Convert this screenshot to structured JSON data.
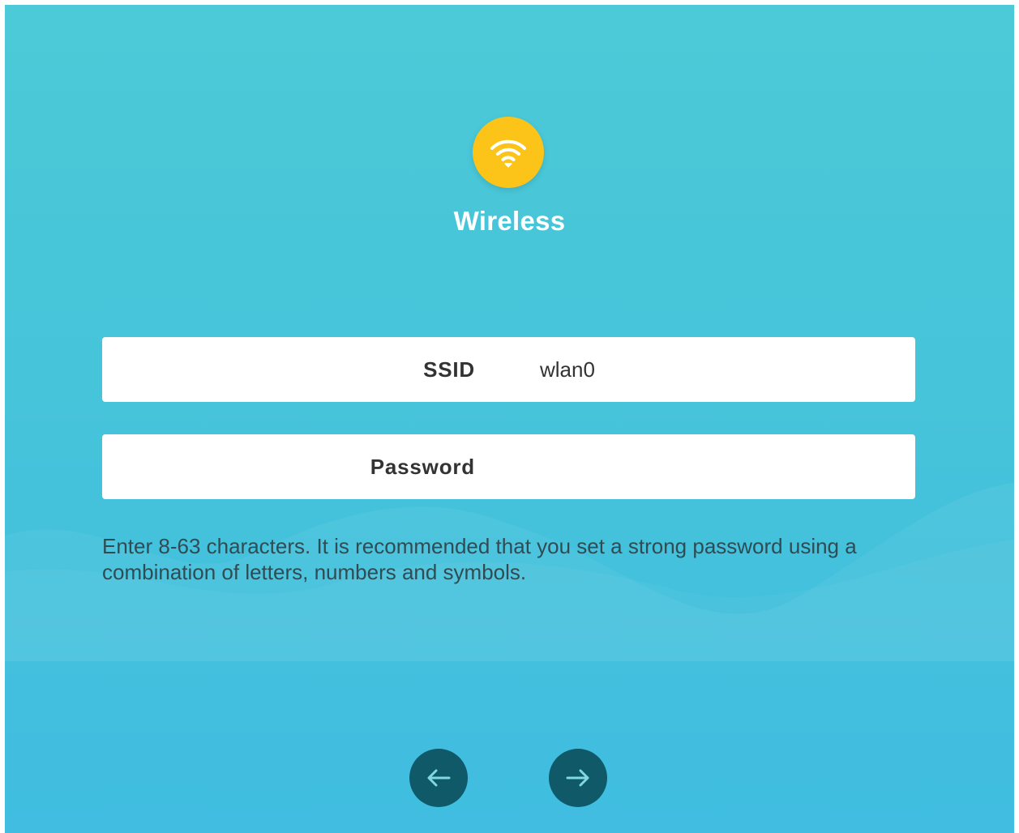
{
  "header": {
    "icon": "wifi-icon",
    "title": "Wireless"
  },
  "form": {
    "ssid": {
      "label": "SSID",
      "value": "wlan0"
    },
    "password": {
      "label": "Password",
      "value": ""
    },
    "hint": "Enter 8-63 characters. It is recommended that you set a strong password using a combination of letters, numbers and symbols."
  },
  "nav": {
    "back_icon": "arrow-left-icon",
    "next_icon": "arrow-right-icon"
  },
  "colors": {
    "background_top": "#4ccad7",
    "background_bottom": "#40bde0",
    "accent_yellow": "#fcc419",
    "nav_button": "#0f5969"
  }
}
